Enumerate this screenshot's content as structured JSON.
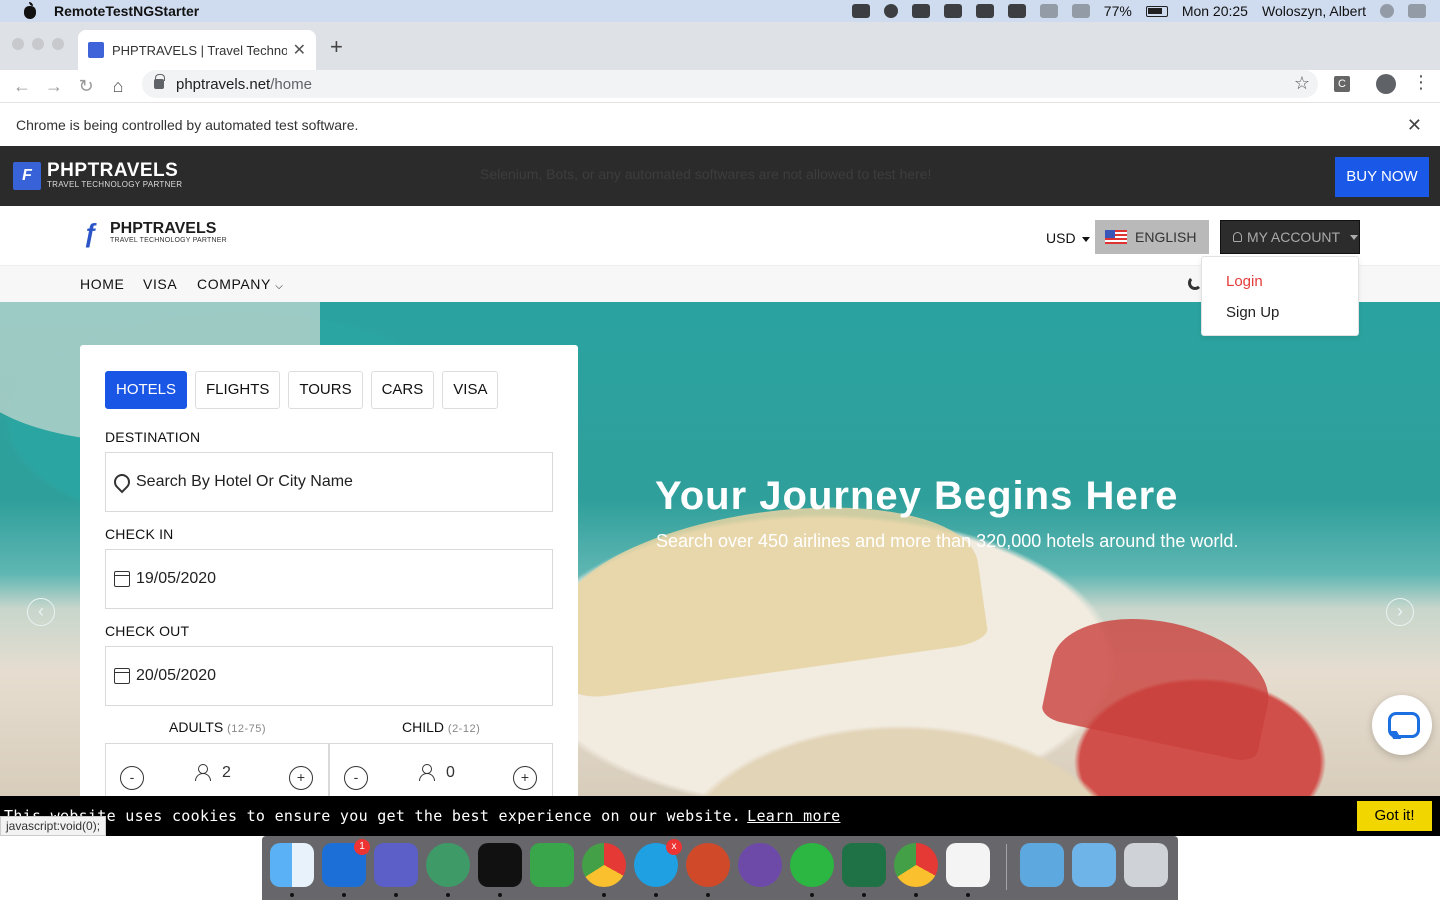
{
  "mac_menu": {
    "app_name": "RemoteTestNGStarter",
    "battery": "77%",
    "clock": "Mon 20:25",
    "user": "Woloszyn, Albert"
  },
  "browser": {
    "tab_title": "PHPTRAVELS | Travel Technolo",
    "url_host": "phptravels.net",
    "url_path": "/home",
    "infobar": "Chrome is being controlled by automated test software.",
    "ext_label": "C"
  },
  "promo_bar": {
    "logo_letter": "F",
    "brand": "PHPTRAVELS",
    "tagline": "TRAVEL TECHNOLOGY PARTNER",
    "notice": "Selenium, Bots, or any automated softwares are not allowed to test here!",
    "buy_label": "BUY NOW"
  },
  "header": {
    "brand": "PHPTRAVELS",
    "tagline": "TRAVEL TECHNOLOGY PARTNER",
    "currency": "USD",
    "language": "ENGLISH",
    "account": "MY ACCOUNT"
  },
  "nav": {
    "items": [
      "HOME",
      "VISA",
      "COMPANY"
    ]
  },
  "account_menu": {
    "login": "Login",
    "signup": "Sign Up"
  },
  "hero": {
    "title": "Your Journey Begins Here",
    "subtitle": "Search over 450 airlines and more than 320,000 hotels around the world."
  },
  "search": {
    "tabs": [
      "HOTELS",
      "FLIGHTS",
      "TOURS",
      "CARS",
      "VISA"
    ],
    "active_tab": "HOTELS",
    "destination_label": "DESTINATION",
    "destination_placeholder": "Search By Hotel Or City Name",
    "checkin_label": "CHECK IN",
    "checkin_value": "19/05/2020",
    "checkout_label": "CHECK OUT",
    "checkout_value": "20/05/2020",
    "adults_label": "ADULTS",
    "adults_range": "(12-75)",
    "adults_value": "2",
    "child_label": "CHILD",
    "child_range": "(2-12)",
    "child_value": "0",
    "minus": "-",
    "plus": "+"
  },
  "cookie": {
    "message": "This website uses cookies to ensure you get the best experience on our website.",
    "learn_more": "Learn more",
    "accept": "Got it!",
    "status_tip": "javascript:void(0);"
  },
  "dock": {
    "apps": [
      "finder",
      "outlook",
      "teams",
      "atom",
      "intellij",
      "excel-x",
      "chrome",
      "skype",
      "powerpoint",
      "github",
      "whatsapp",
      "excel",
      "chrome-2",
      "java"
    ],
    "outlook_badge": "1",
    "skype_badge": "x"
  },
  "colors": {
    "accent_blue": "#1a56e6",
    "buy_blue": "#1a58e8",
    "login_red": "#e53b3b",
    "cookie_yellow": "#f1d600"
  }
}
